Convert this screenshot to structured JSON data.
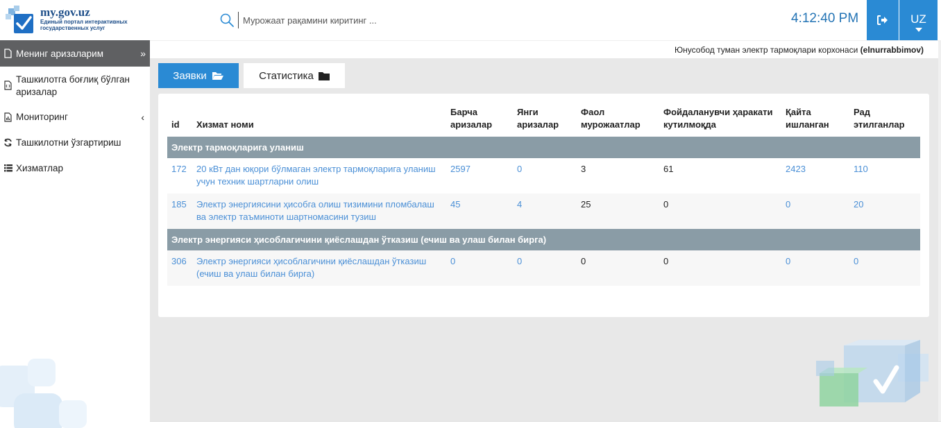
{
  "header": {
    "logo_title": "my.gov.uz",
    "logo_subtitle": "Единый портал интерактивных государственных услуг",
    "search_placeholder": "Мурожаат рақамини киритинг ...",
    "clock": "4:12:40 PM",
    "language": "UZ"
  },
  "sidebar": {
    "items": [
      {
        "label": "Менинг аризаларим",
        "icon": "file-icon",
        "active": true
      },
      {
        "label": "Ташкилотга боғлиқ бўлган аризалар",
        "icon": "file-code-icon"
      },
      {
        "label": "Мониторинг",
        "icon": "chart-file-icon"
      },
      {
        "label": "Ташкилотни ўзгартириш",
        "icon": "refresh-icon"
      },
      {
        "label": "Хизматлар",
        "icon": "list-icon"
      }
    ]
  },
  "user": {
    "organization": "Юнусобод туман электр тармоқлари корхонаси",
    "username": "(elnurrabbimov)"
  },
  "tabs": {
    "requests": "Заявки",
    "statistics": "Статистика"
  },
  "table": {
    "headers": {
      "id": "id",
      "service": "Хизмат номи",
      "all": "Барча аризалар",
      "new": "Янги аризалар",
      "active": "Фаол мурожаатлар",
      "waiting": "Фойдаланувчи ҳаракати кутилмоқда",
      "reworked": "Қайта ишланган",
      "rejected": "Рад этилганлар"
    },
    "groups": [
      {
        "title": "Электр тармоқларига уланиш",
        "rows": [
          {
            "id": "172",
            "service": "20 кВт дан юқори бўлмаган электр тармоқларига уланиш учун техник шартларни олиш",
            "all": "2597",
            "new": "0",
            "active": "3",
            "waiting": "61",
            "reworked": "2423",
            "rejected": "110"
          },
          {
            "id": "185",
            "service": "Электр энергиясини ҳисобга олиш тизимини пломбалаш ва электр таъминоти шартномасини тузиш",
            "all": "45",
            "new": "4",
            "active": "25",
            "waiting": "0",
            "reworked": "0",
            "rejected": "20"
          }
        ]
      },
      {
        "title": "Электр энергияси ҳисоблагичини қиёслашдан ўтказиш (ечиш ва улаш билан бирга)",
        "rows": [
          {
            "id": "306",
            "service": "Электр энергияси ҳисоблагичини қиёслашдан ўтказиш (ечиш ва улаш билан бирга)",
            "all": "0",
            "new": "0",
            "active": "0",
            "waiting": "0",
            "reworked": "0",
            "rejected": "0"
          }
        ]
      }
    ]
  },
  "colors": {
    "accent": "#2a8ad4",
    "link": "#4a8fd6",
    "group_header": "#8a9ca6",
    "sidebar_active": "#5f6062"
  }
}
